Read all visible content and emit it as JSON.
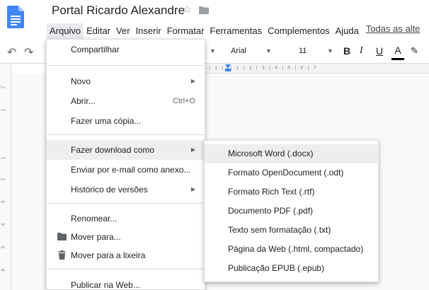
{
  "document": {
    "title": "Portal Ricardo Alexandre",
    "star_icon": "star-outline-icon",
    "folder_icon": "folder-icon"
  },
  "menubar": {
    "items": [
      "Arquivo",
      "Editar",
      "Ver",
      "Inserir",
      "Formatar",
      "Ferramentas",
      "Complementos",
      "Ajuda"
    ],
    "active": "Arquivo",
    "last_edit": "Todas as alte"
  },
  "toolbar": {
    "font": "Arial",
    "font_size": "11",
    "bold": "B",
    "italic": "I",
    "underline": "U",
    "text_color": "A",
    "text_color_value": "#000000",
    "ruler_text": "2 · | · 1 · | ·   · | · 1 · | · 2 · | · 3 · | · 4 · | · 5 · | · 6 · | · 7",
    "vruler_numbers": [
      "2",
      "1",
      "1",
      "2",
      "3",
      "4",
      "5",
      "6"
    ]
  },
  "file_menu": {
    "items": [
      {
        "label": "Compartilhar"
      },
      {
        "label": "Novo",
        "submenu": true
      },
      {
        "label": "Abrir...",
        "shortcut": "Ctrl+O"
      },
      {
        "label": "Fazer uma cópia..."
      },
      {
        "label": "Fazer download como",
        "submenu": true,
        "highlighted": true
      },
      {
        "label": "Enviar por e-mail como anexo..."
      },
      {
        "label": "Histórico de versões",
        "submenu": true
      },
      {
        "label": "Renomear..."
      },
      {
        "label": "Mover para...",
        "icon": "folder-icon"
      },
      {
        "label": "Mover para a lixeira",
        "icon": "trash-icon"
      },
      {
        "label": "Publicar na Web..."
      }
    ]
  },
  "download_submenu": {
    "items": [
      {
        "label": "Microsoft Word (.docx)",
        "highlighted": true
      },
      {
        "label": "Formato OpenDocument (.odt)"
      },
      {
        "label": "Formato Rich Text (.rtf)"
      },
      {
        "label": "Documento PDF (.pdf)"
      },
      {
        "label": "Texto sem formatação (.txt)"
      },
      {
        "label": "Página da Web (.html, compactado)"
      },
      {
        "label": "Publicação EPUB (.epub)"
      }
    ]
  },
  "colors": {
    "docs_blue": "#4285f4",
    "highlight_bg": "#eeeeee",
    "menu_active_bg": "#e8eaed"
  }
}
